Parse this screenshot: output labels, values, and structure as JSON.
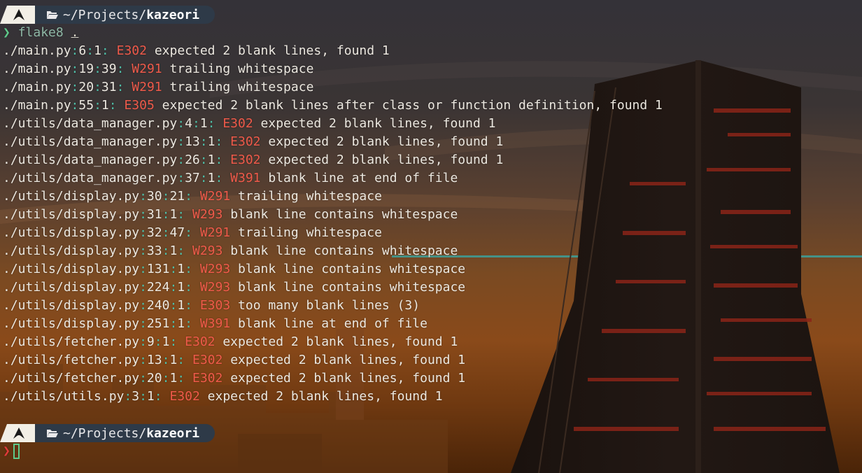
{
  "prompt": {
    "logo_icon": "arch-logo-icon",
    "folder_icon": "folder-open-icon",
    "dir_prefix": "~/Projects/",
    "dir_name": "kazeori",
    "chevron": "❯"
  },
  "command": {
    "name": "flake8",
    "arg": "."
  },
  "output": [
    {
      "file": "./main.py",
      "line": "6",
      "col": "1",
      "code": "E302",
      "msg": "expected 2 blank lines, found 1"
    },
    {
      "file": "./main.py",
      "line": "19",
      "col": "39",
      "code": "W291",
      "msg": "trailing whitespace"
    },
    {
      "file": "./main.py",
      "line": "20",
      "col": "31",
      "code": "W291",
      "msg": "trailing whitespace"
    },
    {
      "file": "./main.py",
      "line": "55",
      "col": "1",
      "code": "E305",
      "msg": "expected 2 blank lines after class or function definition, found 1"
    },
    {
      "file": "./utils/data_manager.py",
      "line": "4",
      "col": "1",
      "code": "E302",
      "msg": "expected 2 blank lines, found 1"
    },
    {
      "file": "./utils/data_manager.py",
      "line": "13",
      "col": "1",
      "code": "E302",
      "msg": "expected 2 blank lines, found 1"
    },
    {
      "file": "./utils/data_manager.py",
      "line": "26",
      "col": "1",
      "code": "E302",
      "msg": "expected 2 blank lines, found 1"
    },
    {
      "file": "./utils/data_manager.py",
      "line": "37",
      "col": "1",
      "code": "W391",
      "msg": "blank line at end of file"
    },
    {
      "file": "./utils/display.py",
      "line": "30",
      "col": "21",
      "code": "W291",
      "msg": "trailing whitespace"
    },
    {
      "file": "./utils/display.py",
      "line": "31",
      "col": "1",
      "code": "W293",
      "msg": "blank line contains whitespace"
    },
    {
      "file": "./utils/display.py",
      "line": "32",
      "col": "47",
      "code": "W291",
      "msg": "trailing whitespace"
    },
    {
      "file": "./utils/display.py",
      "line": "33",
      "col": "1",
      "code": "W293",
      "msg": "blank line contains whitespace"
    },
    {
      "file": "./utils/display.py",
      "line": "131",
      "col": "1",
      "code": "W293",
      "msg": "blank line contains whitespace"
    },
    {
      "file": "./utils/display.py",
      "line": "224",
      "col": "1",
      "code": "W293",
      "msg": "blank line contains whitespace"
    },
    {
      "file": "./utils/display.py",
      "line": "240",
      "col": "1",
      "code": "E303",
      "msg": "too many blank lines (3)"
    },
    {
      "file": "./utils/display.py",
      "line": "251",
      "col": "1",
      "code": "W391",
      "msg": "blank line at end of file"
    },
    {
      "file": "./utils/fetcher.py",
      "line": "9",
      "col": "1",
      "code": "E302",
      "msg": "expected 2 blank lines, found 1"
    },
    {
      "file": "./utils/fetcher.py",
      "line": "13",
      "col": "1",
      "code": "E302",
      "msg": "expected 2 blank lines, found 1"
    },
    {
      "file": "./utils/fetcher.py",
      "line": "20",
      "col": "1",
      "code": "E302",
      "msg": "expected 2 blank lines, found 1"
    },
    {
      "file": "./utils/utils.py",
      "line": "3",
      "col": "1",
      "code": "E302",
      "msg": "expected 2 blank lines, found 1"
    }
  ],
  "colors": {
    "error_code": "#ef5a4a",
    "separator": "#4fbfa8",
    "prompt_ok": "#5ec98a",
    "prompt_err": "#e23a3a",
    "dir_segment_bg": "#2e3a48",
    "logo_segment_bg": "#f2efe6"
  }
}
